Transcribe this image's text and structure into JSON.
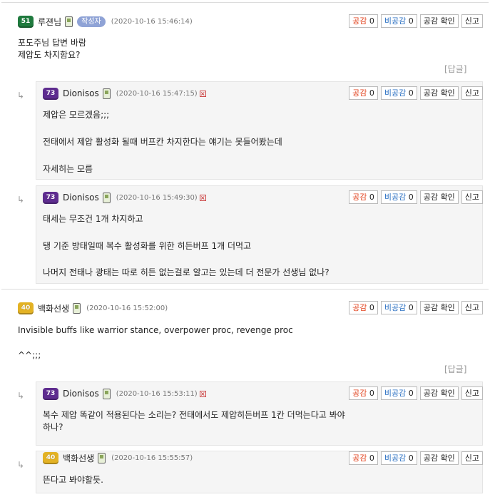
{
  "buttons": {
    "like_label": "공감",
    "dislike_label": "비공감",
    "check_label": "공감 확인",
    "report_label": "신고",
    "reply_label": "[답글]"
  },
  "comments": [
    {
      "level": "51",
      "nick": "루젼님",
      "author_tag": "작성자",
      "date": "(2020-10-16 15:46:14)",
      "likes": "0",
      "dislikes": "0",
      "lines": [
        "포도주님 답변 바람",
        "제압도 차지함요?"
      ]
    },
    {
      "level": "73",
      "nick": "Dionisos",
      "date": "(2020-10-16 15:47:15)",
      "likes": "0",
      "dislikes": "0",
      "lines": [
        "제압은 모르겠음;;;",
        "전태에서 제압 활성화 될때 버프칸 차지한다는 얘기는 못들어봤는데",
        "자세히는 모름"
      ]
    },
    {
      "level": "73",
      "nick": "Dionisos",
      "date": "(2020-10-16 15:49:30)",
      "likes": "0",
      "dislikes": "0",
      "lines": [
        "태세는 무조건 1개 차지하고",
        "탱 기준 방태일때 복수 활성화를 위한 히든버프 1개 더먹고",
        "나머지 전태나 광태는 따로 히든 없는걸로 알고는 있는데 더 전문가 선생님 없나?"
      ]
    },
    {
      "level": "40",
      "nick": "백화선생",
      "date": "(2020-10-16 15:52:00)",
      "likes": "0",
      "dislikes": "0",
      "lines": [
        "Invisible buffs like warrior stance, overpower proc, revenge proc",
        "^^;;;"
      ]
    },
    {
      "level": "73",
      "nick": "Dionisos",
      "date": "(2020-10-16 15:53:11)",
      "likes": "0",
      "dislikes": "0",
      "lines": [
        "복수 제압 똑같이 적용된다는 소리는? 전태에서도 제압히든버프 1칸 더먹는다고 봐야",
        "하나?"
      ]
    },
    {
      "level": "40",
      "nick": "백화선생",
      "date": "(2020-10-16 15:55:57)",
      "likes": "0",
      "dislikes": "0",
      "lines": [
        "뜬다고 봐야할듯."
      ]
    }
  ],
  "colors": {
    "like": "#e2421d",
    "dislike": "#2a6fc2",
    "level_51": "#1f7a3e",
    "level_73": "#5e2c8f",
    "level_40": "#e3b224",
    "reply_bg": "#f5f5f5"
  },
  "icons": {
    "reply_arrow": "↳",
    "phone": "phone-icon",
    "delete": "delete-icon"
  }
}
